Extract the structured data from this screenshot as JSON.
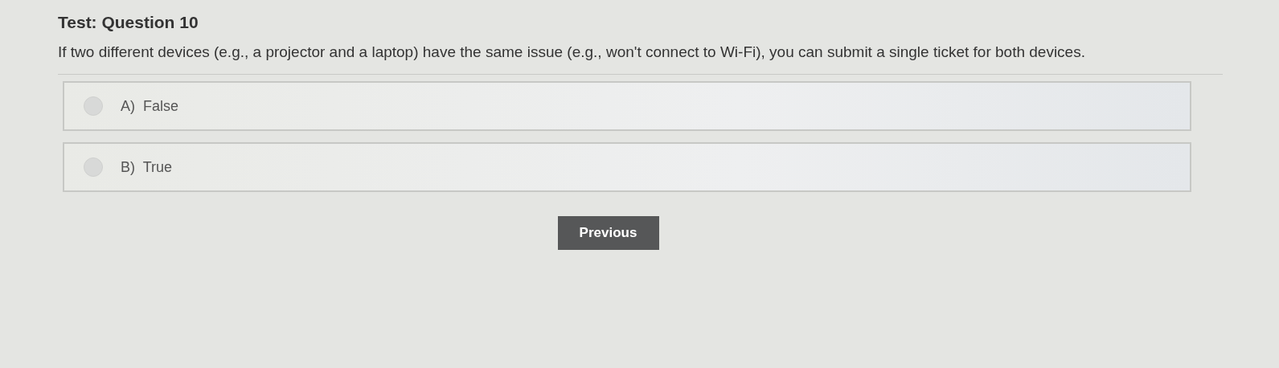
{
  "title": "Test: Question 10",
  "question": "If two different devices (e.g., a projector and a laptop) have the same issue (e.g., won't connect to Wi-Fi), you can submit a single ticket for both devices.",
  "options": [
    {
      "letter": "A)",
      "label": "False",
      "selected": false
    },
    {
      "letter": "B)",
      "label": "True",
      "selected": false
    }
  ],
  "buttons": [
    {
      "label": "Previous"
    }
  ]
}
